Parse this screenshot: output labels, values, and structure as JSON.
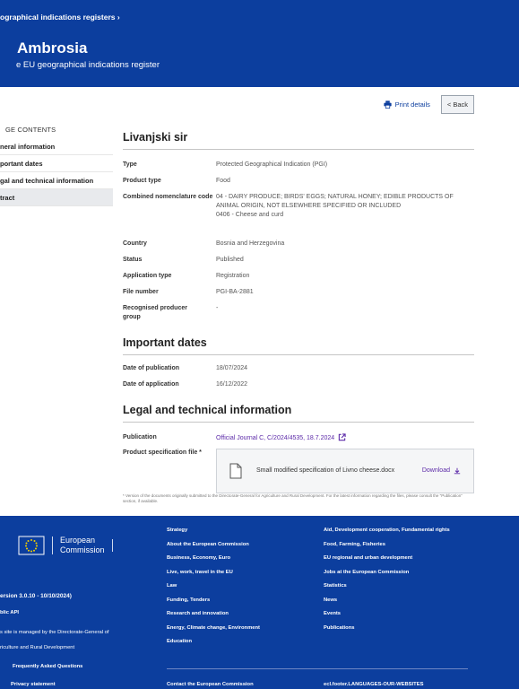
{
  "header": {
    "breadcrumb": "ographical indications registers",
    "breadcrumb_sep": "›",
    "title": "Ambrosia",
    "subtitle": "e EU geographical indications register"
  },
  "toolbar": {
    "print_label": "Print details",
    "back_label": "< Back"
  },
  "toc": {
    "title": "GE CONTENTS",
    "items": [
      {
        "label": "neral information"
      },
      {
        "label": "portant dates"
      },
      {
        "label": "gal and technical information"
      },
      {
        "label": "tract"
      }
    ],
    "active_index": 3
  },
  "product": {
    "name": "Livanjski sir",
    "fields": [
      {
        "label": "Type",
        "value": "Protected Geographical Indication (PGI)"
      },
      {
        "label": "Product type",
        "value": "Food"
      },
      {
        "label": "Combined nomenclature code",
        "value": "04 - DAIRY PRODUCE; BIRDS' EGGS; NATURAL HONEY; EDIBLE PRODUCTS OF ANIMAL ORIGIN, NOT ELSEWHERE SPECIFIED OR INCLUDED",
        "value2": "0406 - Cheese and curd"
      },
      {
        "label": "Country",
        "value": "Bosnia and Herzegovina"
      },
      {
        "label": "Status",
        "value": "Published"
      },
      {
        "label": "Application type",
        "value": "Registration"
      },
      {
        "label": "File number",
        "value": "PGI-BA-2881"
      },
      {
        "label": "Recognised producer group",
        "value": "-"
      }
    ]
  },
  "dates": {
    "heading": "Important dates",
    "publication_label": "Date of publication",
    "publication_value": "18/07/2024",
    "application_label": "Date of application",
    "application_value": "16/12/2022"
  },
  "legal": {
    "heading": "Legal and technical information",
    "publication_label": "Publication",
    "publication_value": "Official Journal C, C/2024/4535, 18.7.2024",
    "spec_label": "Product specification file *",
    "file_name": "Small modified specification of Livno cheese.docx",
    "download_label": "Download"
  },
  "footnote": "* Version of the documents originally submitted to the Directorate-General for Agriculture and Rural Development. For the latest information regarding the files, please consult the \"Publication\" section, if available.",
  "footer": {
    "logo_line1": "European",
    "logo_line2": "Commission",
    "version": "ersion 3.0.10 - 10/10/2024)",
    "api": "blic API",
    "managed1": "s site is managed by the Directorate-General of",
    "managed2": "riculture and Rural Development",
    "col1": [
      "Strategy",
      "About the European Commission",
      "Business, Economy, Euro",
      "Live, work, travel in the EU",
      "Law",
      "Funding, Tenders",
      "Research and innovation",
      "Energy, Climate change, Environment",
      "Education"
    ],
    "col2": [
      "Aid, Development cooperation, Fundamental rights",
      "Food, Farming, Fisheries",
      "EU regional and urban development",
      "Jobs at the European Commission",
      "Statistics",
      "News",
      "Events",
      "Publications"
    ],
    "faq": "Frequently Asked Questions",
    "privacy": "Privacy statement",
    "contact": "Contact the European Commission",
    "languages": "ecl.footer.LANGUAGES-OUR-WEBSITES"
  },
  "colors": {
    "header_bg": "#0c3e9e",
    "link": "#5c2aa8"
  }
}
